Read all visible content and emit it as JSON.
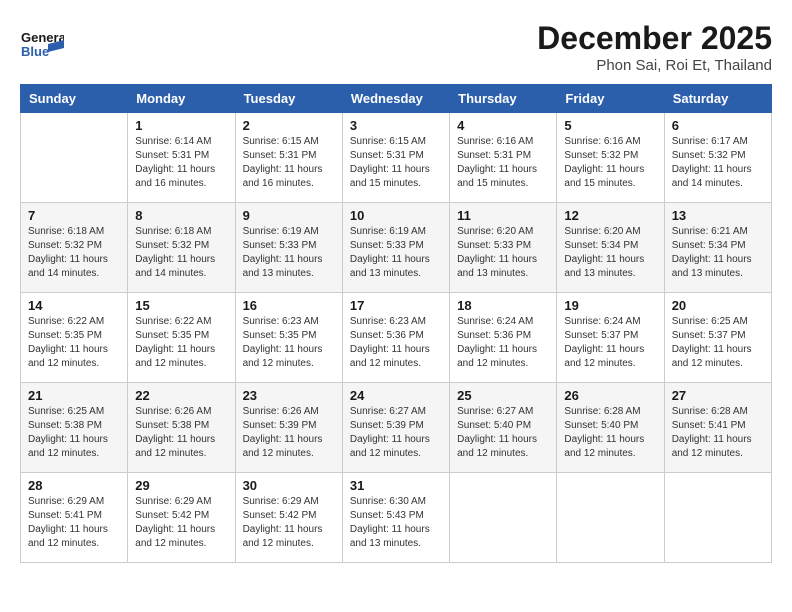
{
  "header": {
    "logo_general": "General",
    "logo_blue": "Blue",
    "title": "December 2025",
    "subtitle": "Phon Sai, Roi Et, Thailand"
  },
  "weekdays": [
    "Sunday",
    "Monday",
    "Tuesday",
    "Wednesday",
    "Thursday",
    "Friday",
    "Saturday"
  ],
  "weeks": [
    [
      {
        "day": "",
        "info": ""
      },
      {
        "day": "1",
        "info": "Sunrise: 6:14 AM\nSunset: 5:31 PM\nDaylight: 11 hours\nand 16 minutes."
      },
      {
        "day": "2",
        "info": "Sunrise: 6:15 AM\nSunset: 5:31 PM\nDaylight: 11 hours\nand 16 minutes."
      },
      {
        "day": "3",
        "info": "Sunrise: 6:15 AM\nSunset: 5:31 PM\nDaylight: 11 hours\nand 15 minutes."
      },
      {
        "day": "4",
        "info": "Sunrise: 6:16 AM\nSunset: 5:31 PM\nDaylight: 11 hours\nand 15 minutes."
      },
      {
        "day": "5",
        "info": "Sunrise: 6:16 AM\nSunset: 5:32 PM\nDaylight: 11 hours\nand 15 minutes."
      },
      {
        "day": "6",
        "info": "Sunrise: 6:17 AM\nSunset: 5:32 PM\nDaylight: 11 hours\nand 14 minutes."
      }
    ],
    [
      {
        "day": "7",
        "info": "Sunrise: 6:18 AM\nSunset: 5:32 PM\nDaylight: 11 hours\nand 14 minutes."
      },
      {
        "day": "8",
        "info": "Sunrise: 6:18 AM\nSunset: 5:32 PM\nDaylight: 11 hours\nand 14 minutes."
      },
      {
        "day": "9",
        "info": "Sunrise: 6:19 AM\nSunset: 5:33 PM\nDaylight: 11 hours\nand 13 minutes."
      },
      {
        "day": "10",
        "info": "Sunrise: 6:19 AM\nSunset: 5:33 PM\nDaylight: 11 hours\nand 13 minutes."
      },
      {
        "day": "11",
        "info": "Sunrise: 6:20 AM\nSunset: 5:33 PM\nDaylight: 11 hours\nand 13 minutes."
      },
      {
        "day": "12",
        "info": "Sunrise: 6:20 AM\nSunset: 5:34 PM\nDaylight: 11 hours\nand 13 minutes."
      },
      {
        "day": "13",
        "info": "Sunrise: 6:21 AM\nSunset: 5:34 PM\nDaylight: 11 hours\nand 13 minutes."
      }
    ],
    [
      {
        "day": "14",
        "info": "Sunrise: 6:22 AM\nSunset: 5:35 PM\nDaylight: 11 hours\nand 12 minutes."
      },
      {
        "day": "15",
        "info": "Sunrise: 6:22 AM\nSunset: 5:35 PM\nDaylight: 11 hours\nand 12 minutes."
      },
      {
        "day": "16",
        "info": "Sunrise: 6:23 AM\nSunset: 5:35 PM\nDaylight: 11 hours\nand 12 minutes."
      },
      {
        "day": "17",
        "info": "Sunrise: 6:23 AM\nSunset: 5:36 PM\nDaylight: 11 hours\nand 12 minutes."
      },
      {
        "day": "18",
        "info": "Sunrise: 6:24 AM\nSunset: 5:36 PM\nDaylight: 11 hours\nand 12 minutes."
      },
      {
        "day": "19",
        "info": "Sunrise: 6:24 AM\nSunset: 5:37 PM\nDaylight: 11 hours\nand 12 minutes."
      },
      {
        "day": "20",
        "info": "Sunrise: 6:25 AM\nSunset: 5:37 PM\nDaylight: 11 hours\nand 12 minutes."
      }
    ],
    [
      {
        "day": "21",
        "info": "Sunrise: 6:25 AM\nSunset: 5:38 PM\nDaylight: 11 hours\nand 12 minutes."
      },
      {
        "day": "22",
        "info": "Sunrise: 6:26 AM\nSunset: 5:38 PM\nDaylight: 11 hours\nand 12 minutes."
      },
      {
        "day": "23",
        "info": "Sunrise: 6:26 AM\nSunset: 5:39 PM\nDaylight: 11 hours\nand 12 minutes."
      },
      {
        "day": "24",
        "info": "Sunrise: 6:27 AM\nSunset: 5:39 PM\nDaylight: 11 hours\nand 12 minutes."
      },
      {
        "day": "25",
        "info": "Sunrise: 6:27 AM\nSunset: 5:40 PM\nDaylight: 11 hours\nand 12 minutes."
      },
      {
        "day": "26",
        "info": "Sunrise: 6:28 AM\nSunset: 5:40 PM\nDaylight: 11 hours\nand 12 minutes."
      },
      {
        "day": "27",
        "info": "Sunrise: 6:28 AM\nSunset: 5:41 PM\nDaylight: 11 hours\nand 12 minutes."
      }
    ],
    [
      {
        "day": "28",
        "info": "Sunrise: 6:29 AM\nSunset: 5:41 PM\nDaylight: 11 hours\nand 12 minutes."
      },
      {
        "day": "29",
        "info": "Sunrise: 6:29 AM\nSunset: 5:42 PM\nDaylight: 11 hours\nand 12 minutes."
      },
      {
        "day": "30",
        "info": "Sunrise: 6:29 AM\nSunset: 5:42 PM\nDaylight: 11 hours\nand 12 minutes."
      },
      {
        "day": "31",
        "info": "Sunrise: 6:30 AM\nSunset: 5:43 PM\nDaylight: 11 hours\nand 13 minutes."
      },
      {
        "day": "",
        "info": ""
      },
      {
        "day": "",
        "info": ""
      },
      {
        "day": "",
        "info": ""
      }
    ]
  ]
}
